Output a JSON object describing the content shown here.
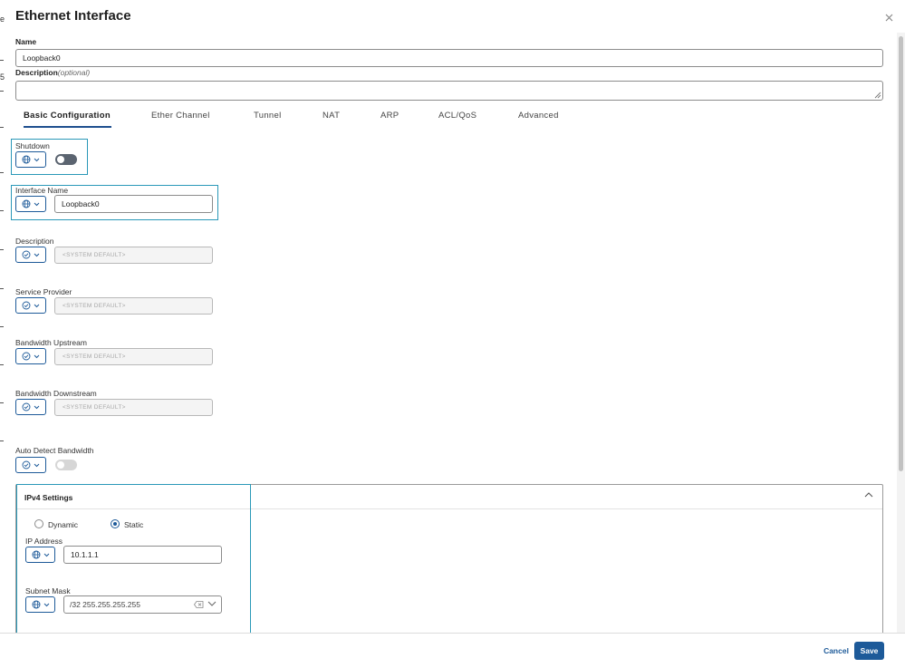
{
  "window": {
    "title": "Ethernet Interface"
  },
  "name_field": {
    "label": "Name",
    "value": "Loopback0"
  },
  "description_field": {
    "label": "Description",
    "optional": "(optional)",
    "value": ""
  },
  "tabs": [
    {
      "label": "Basic Configuration",
      "active": true
    },
    {
      "label": "Ether Channel",
      "active": false
    },
    {
      "label": "Tunnel",
      "active": false
    },
    {
      "label": "NAT",
      "active": false
    },
    {
      "label": "ARP",
      "active": false
    },
    {
      "label": "ACL/QoS",
      "active": false
    },
    {
      "label": "Advanced",
      "active": false
    }
  ],
  "fields": {
    "shutdown": {
      "label": "Shutdown",
      "scope_icon": "globe-icon",
      "toggle": "off"
    },
    "interface_name": {
      "label": "Interface Name",
      "scope_icon": "globe-icon",
      "value": "Loopback0"
    },
    "description": {
      "label": "Description",
      "scope_icon": "check-circle-icon",
      "placeholder": "<SYSTEM DEFAULT>"
    },
    "service_provider": {
      "label": "Service Provider",
      "scope_icon": "check-circle-icon",
      "placeholder": "<SYSTEM DEFAULT>"
    },
    "bandwidth_upstream": {
      "label": "Bandwidth Upstream",
      "scope_icon": "check-circle-icon",
      "placeholder": "<SYSTEM DEFAULT>"
    },
    "bandwidth_downstream": {
      "label": "Bandwidth Downstream",
      "scope_icon": "check-circle-icon",
      "placeholder": "<SYSTEM DEFAULT>"
    },
    "auto_detect_bandwidth": {
      "label": "Auto Detect Bandwidth",
      "scope_icon": "check-circle-icon",
      "toggle": "off"
    }
  },
  "ipv4": {
    "title": "IPv4 Settings",
    "mode_options": [
      {
        "label": "Dynamic",
        "checked": false
      },
      {
        "label": "Static",
        "checked": true
      }
    ],
    "ip_address": {
      "label": "IP Address",
      "scope_icon": "globe-icon",
      "value": "10.1.1.1"
    },
    "subnet_mask": {
      "label": "Subnet Mask",
      "scope_icon": "globe-icon",
      "value": "/32 255.255.255.255"
    }
  },
  "footer": {
    "cancel_label": "Cancel",
    "save_label": "Save"
  },
  "colors": {
    "accent": "#1d5a99",
    "highlight": "#2a98b8",
    "toggle_dark": "#5b6470"
  },
  "edge_chars": [
    "e",
    "5"
  ]
}
